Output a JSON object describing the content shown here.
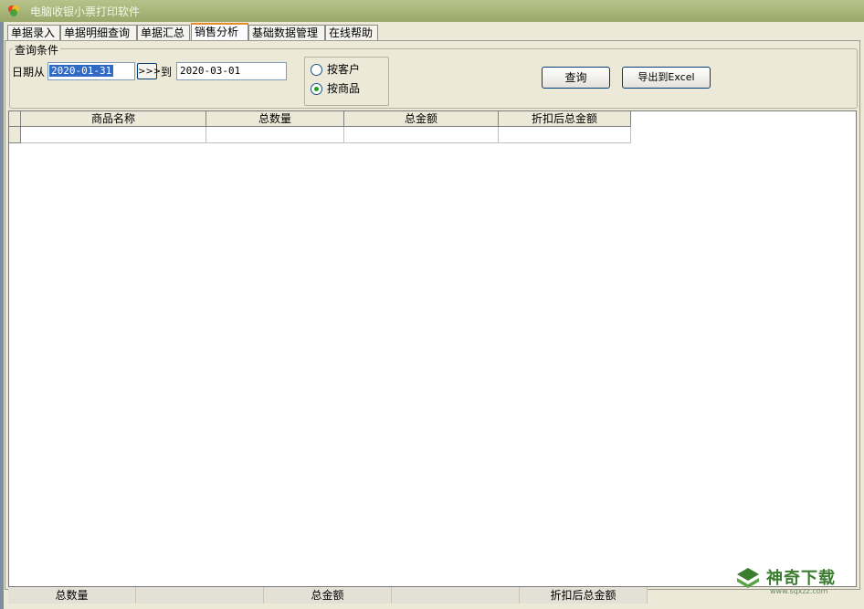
{
  "window": {
    "title": "电脑收银小票打印软件"
  },
  "tabs": [
    {
      "label": "单据录入"
    },
    {
      "label": "单据明细查询"
    },
    {
      "label": "单据汇总"
    },
    {
      "label": "销售分析",
      "active": true
    },
    {
      "label": "基础数据管理"
    },
    {
      "label": "在线帮助"
    }
  ],
  "query": {
    "group_title": "查询条件",
    "date_from_label": "日期从",
    "date_from": "2020-01-31",
    "next_button": ">>>",
    "to_label": "到",
    "date_to": "2020-03-01",
    "radio": [
      {
        "label": "按客户",
        "checked": false
      },
      {
        "label": "按商品",
        "checked": true
      }
    ],
    "search_button": "查询",
    "export_button": "导出到Excel"
  },
  "grid": {
    "columns": [
      "商品名称",
      "总数量",
      "总金额",
      "折扣后总金额"
    ]
  },
  "footer": {
    "cells": [
      "总数量",
      "",
      "总金额",
      "",
      "折扣后总金额"
    ]
  },
  "watermark": {
    "text": "神奇下载",
    "sub": "www.sqxzz.com"
  },
  "colors": {
    "accent_tab": "#e68b2c",
    "selection": "#316ac5",
    "radio_dot": "#21a121"
  }
}
